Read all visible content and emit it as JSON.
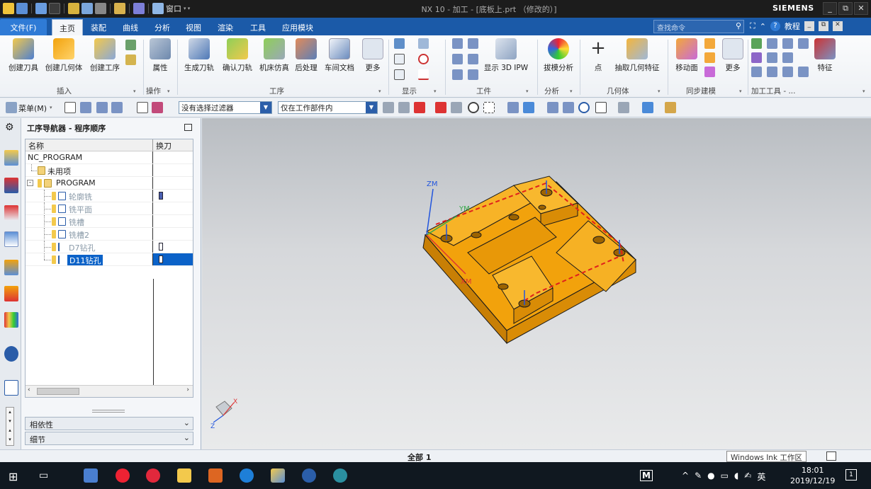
{
  "titlebar": {
    "title": "NX 10 - 加工 - [底板上.prt （修改的）]",
    "brand": "SIEMENS",
    "window_menu": "窗口",
    "min": "_",
    "restore": "⧉",
    "close": "✕"
  },
  "menubar": {
    "tabs": [
      "文件(F)",
      "主页",
      "装配",
      "曲线",
      "分析",
      "视图",
      "渲染",
      "工具",
      "应用模块"
    ],
    "active_tab": "主页",
    "search_placeholder": "查找命令",
    "tutorial": "教程"
  },
  "ribbon": {
    "groups": {
      "insert": "插入",
      "operation": "操作",
      "process": "工序",
      "display": "显示",
      "workpiece": "工件",
      "analysis": "分析",
      "geometry": "几何体",
      "sync": "同步建模",
      "mfg_tools": "加工工具 - ..."
    },
    "buttons": {
      "create_tool": "创建刀具",
      "create_geometry": "创建几何体",
      "create_operation": "创建工序",
      "properties": "属性",
      "generate_path": "生成刀轨",
      "verify_path": "确认刀轨",
      "machine_sim": "机床仿真",
      "post_process": "后处理",
      "shop_doc": "车间文档",
      "more1": "更多",
      "show_3d_ipw": "显示 3D IPW",
      "draft_analysis": "拔模分析",
      "point": "点",
      "extract_geometry": "抽取几何特征",
      "move_face": "移动面",
      "more2": "更多",
      "feature": "特征"
    }
  },
  "toolbar2": {
    "menu_label": "菜单(M)",
    "filter_value": "没有选择过滤器",
    "scope_value": "仅在工作部件内"
  },
  "navigator": {
    "title": "工序导航器 - 程序顺序",
    "col_name": "名称",
    "col_toolchange": "换刀",
    "rows": [
      {
        "label": "NC_PROGRAM"
      },
      {
        "label": "未用项"
      },
      {
        "label": "PROGRAM"
      },
      {
        "label": "轮廓铣"
      },
      {
        "label": "铣平面"
      },
      {
        "label": "铣槽"
      },
      {
        "label": "铣槽2"
      },
      {
        "label": "D7钻孔"
      },
      {
        "label": "D11钻孔"
      }
    ],
    "panel_dependency": "相依性",
    "panel_details": "细节"
  },
  "viewport": {
    "axis_zm": "ZM",
    "axis_ym": "YM",
    "axis_xm": "XM",
    "triad_x": "X",
    "triad_z": "Z",
    "part_color": "#f2a20c"
  },
  "statusbar": {
    "status": "全部 1",
    "ink": "Windows Ink 工作区"
  },
  "taskbar": {
    "time": "18:01",
    "date": "2019/12/19",
    "ime": "英",
    "ime_mode": "M"
  }
}
